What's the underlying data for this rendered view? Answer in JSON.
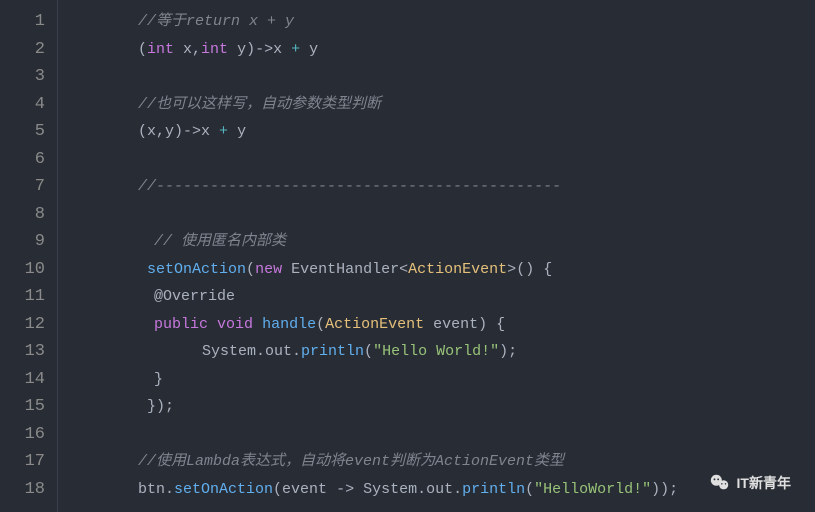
{
  "line_numbers": [
    "1",
    "2",
    "3",
    "4",
    "5",
    "6",
    "7",
    "8",
    "9",
    "10",
    "11",
    "12",
    "13",
    "14",
    "15",
    "16",
    "17",
    "18"
  ],
  "code": {
    "l1": "//等于return x + y",
    "l2": {
      "kw_int1": "int",
      "var_x": " x,",
      "kw_int2": "int",
      "var_y": " y",
      "arrow": ")->",
      "expr": "x ",
      "plus": "+",
      "rest": " y"
    },
    "l4": "//也可以这样写，自动参数类型判断",
    "l5": {
      "open": "(x,y)",
      "arrow": "->",
      "expr": "x ",
      "plus": "+",
      "rest": " y"
    },
    "l7": "//---------------------------------------------",
    "l9": "// 使用匿名内部类",
    "l10": {
      "fn": "setOnAction",
      "open": "(",
      "kw_new": "new",
      "sp": " ",
      "cls": "EventHandler",
      "lt": "<",
      "cls2": "ActionEvent",
      "gt": ">",
      "rest": "() {"
    },
    "l11": "@Override",
    "l12": {
      "kw_pub": "public",
      "sp1": " ",
      "kw_void": "void",
      "sp2": " ",
      "fn": "handle",
      "open": "(",
      "cls": "ActionEvent",
      "param": " event) {"
    },
    "l13": {
      "obj": "System.out.",
      "fn": "println",
      "open": "(",
      "str": "\"Hello World!\"",
      "close": ");"
    },
    "l14": "}",
    "l15": "});",
    "l17": "//使用Lambda表达式，自动将event判断为ActionEvent类型",
    "l18": {
      "obj": "btn.",
      "fn": "setOnAction",
      "open": "(event ",
      "arrow": "->",
      "mid": " System.out.",
      "fn2": "println",
      "open2": "(",
      "str": "\"HelloWorld!\"",
      "close": "));"
    }
  },
  "watermark": {
    "label": "IT新青年"
  }
}
